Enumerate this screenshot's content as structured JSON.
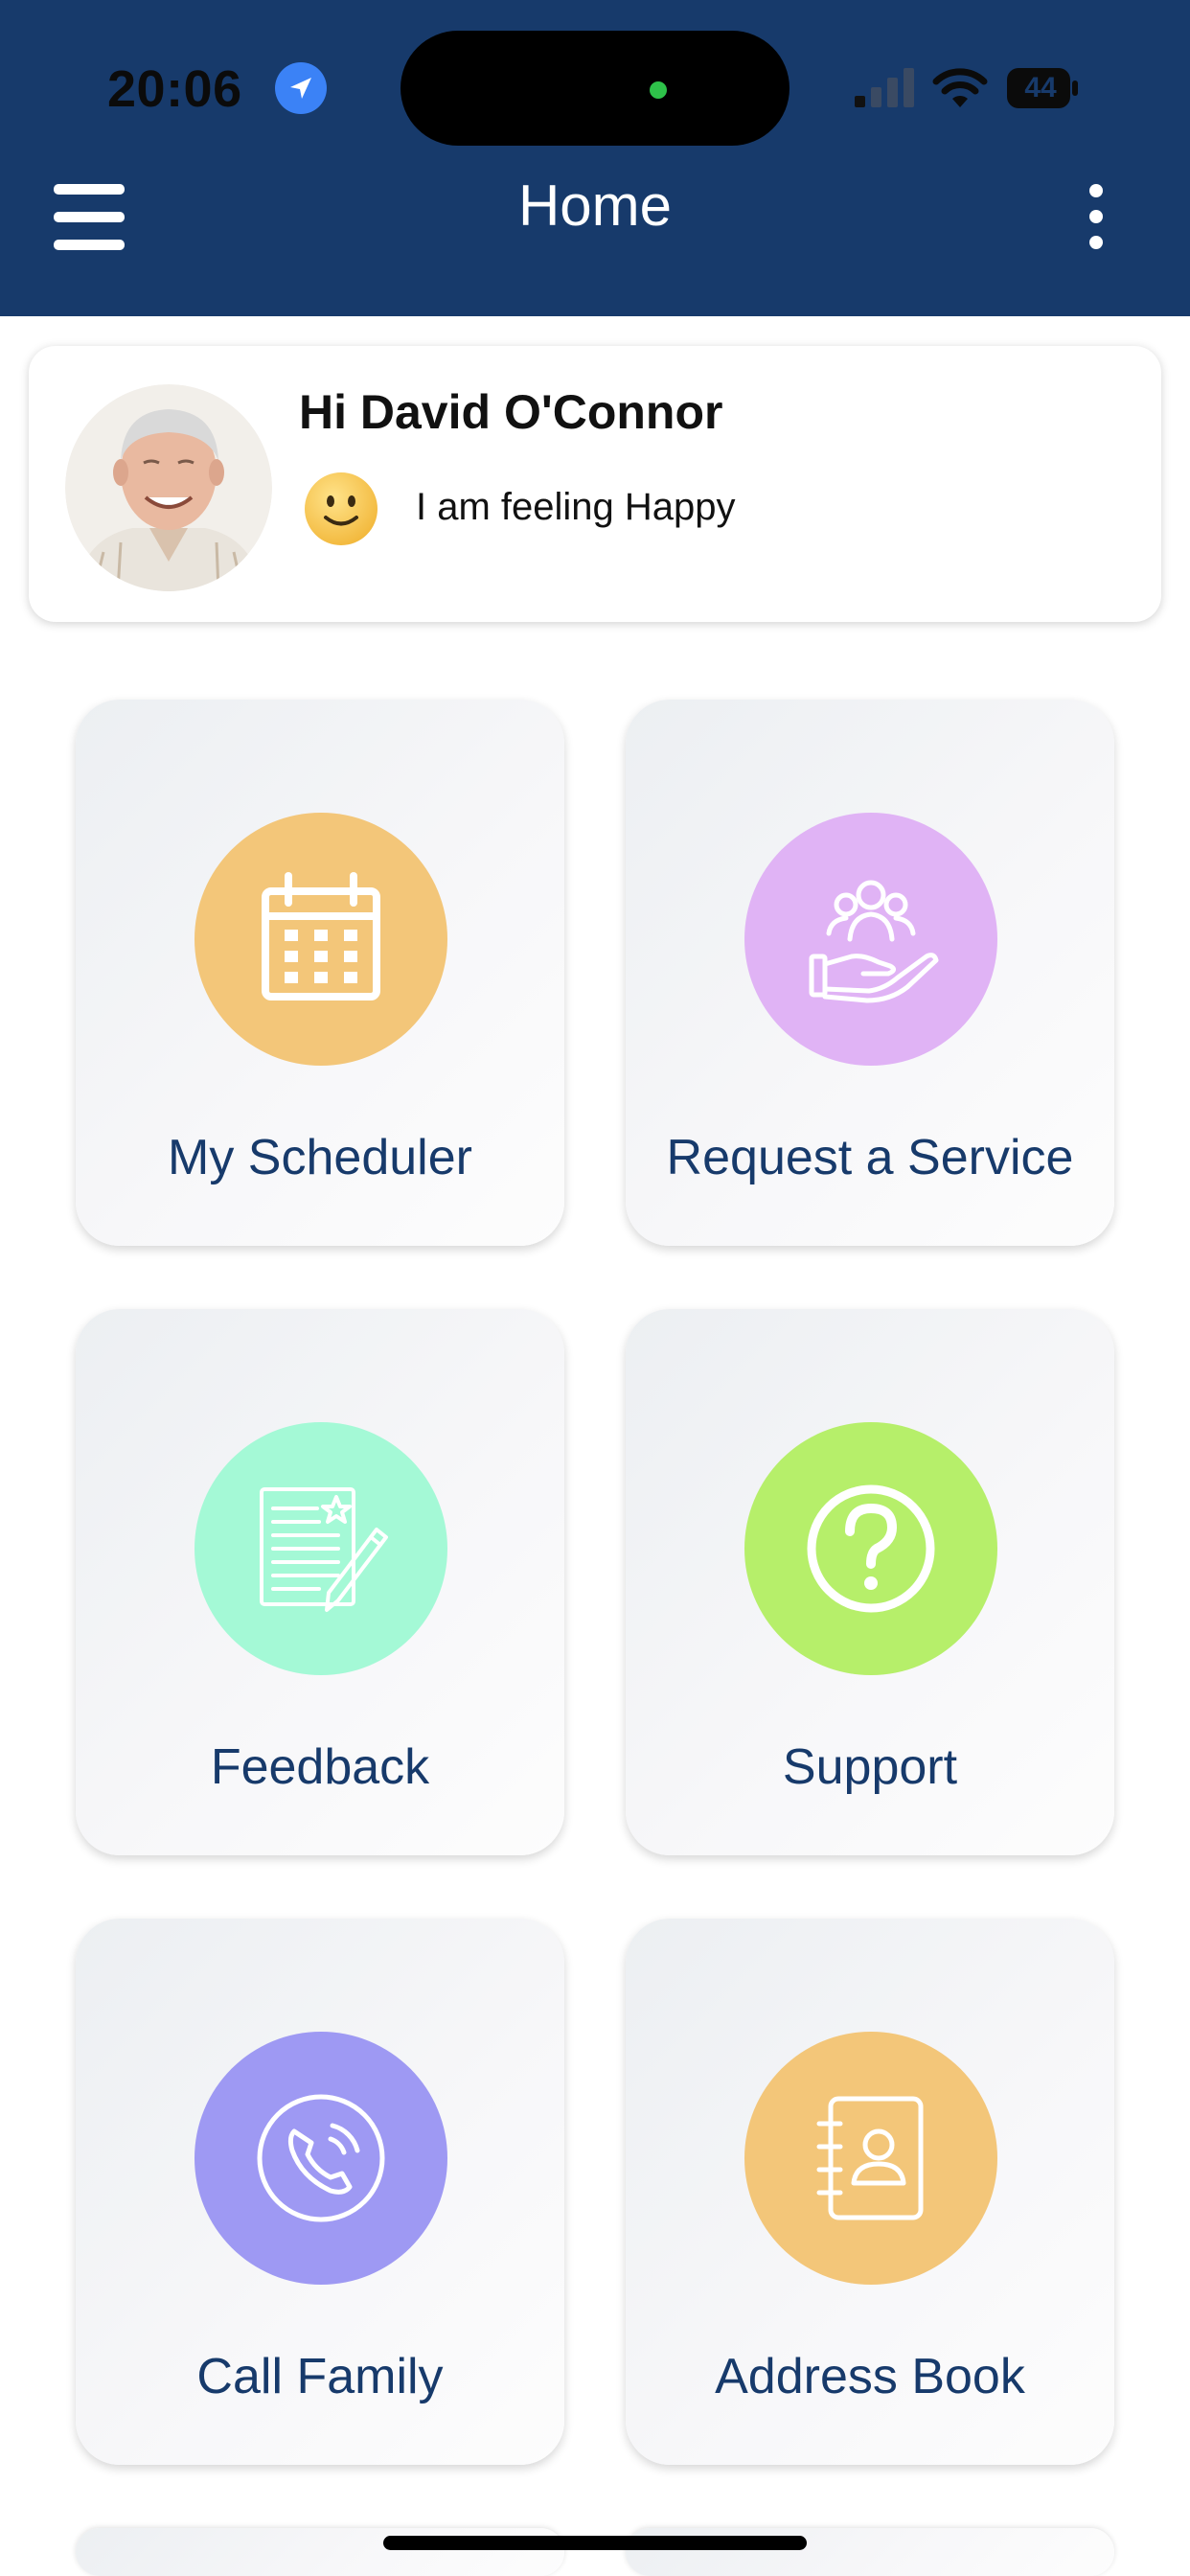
{
  "status_bar": {
    "time": "20:06",
    "battery": "44",
    "location_icon": "location-arrow-icon",
    "signal_icon": "cellular-signal-icon",
    "wifi_icon": "wifi-icon",
    "battery_icon": "battery-icon"
  },
  "header": {
    "title": "Home",
    "menu_icon": "hamburger-menu-icon",
    "more_icon": "more-vertical-icon",
    "background": "#173a6b"
  },
  "profile": {
    "greeting": "Hi David O'Connor",
    "mood": "I am feeling Happy",
    "mood_icon": "smiley-face-icon"
  },
  "tiles": [
    {
      "label": "My Scheduler",
      "icon": "calendar-icon",
      "color": "#f3c679"
    },
    {
      "label": "Request a Service",
      "icon": "hand-group-service-icon",
      "color": "#e0b3f5"
    },
    {
      "label": "Feedback",
      "icon": "feedback-document-pen-icon",
      "color": "#a4f9d6"
    },
    {
      "label": "Support",
      "icon": "question-mark-icon",
      "color": "#b6ef6a"
    },
    {
      "label": "Call Family",
      "icon": "phone-call-icon",
      "color": "#9e99f3"
    },
    {
      "label": "Address Book",
      "icon": "address-book-icon",
      "color": "#f3c679"
    }
  ],
  "theme": {
    "label_color": "#173a6b"
  }
}
